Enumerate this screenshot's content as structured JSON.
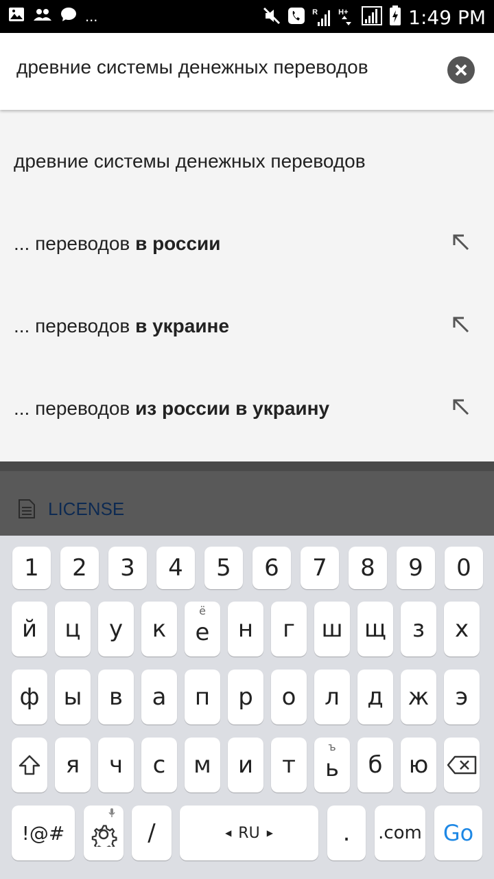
{
  "status_bar": {
    "time": "1:49 PM",
    "overflow": "...",
    "network_r": "R",
    "network_h": "H+"
  },
  "search": {
    "query": "древние системы денежных переводов"
  },
  "suggestions": [
    {
      "prefix": "древние системы денежных переводов",
      "bold": "",
      "has_arrow": false
    },
    {
      "prefix": "... переводов ",
      "bold": "в россии",
      "has_arrow": true
    },
    {
      "prefix": "... переводов ",
      "bold": "в украине",
      "has_arrow": true
    },
    {
      "prefix": "... переводов ",
      "bold": "из россии в украину",
      "has_arrow": true
    }
  ],
  "panel": {
    "license_label": "LICENSE"
  },
  "keyboard": {
    "numbers": [
      "1",
      "2",
      "3",
      "4",
      "5",
      "6",
      "7",
      "8",
      "9",
      "0"
    ],
    "row1": [
      "й",
      "ц",
      "у",
      "к",
      "е",
      "н",
      "г",
      "ш",
      "щ",
      "з",
      "х"
    ],
    "row1_sup_e": "ё",
    "row2": [
      "ф",
      "ы",
      "в",
      "а",
      "п",
      "р",
      "о",
      "л",
      "д",
      "ж",
      "э"
    ],
    "row3": [
      "я",
      "ч",
      "с",
      "м",
      "и",
      "т",
      "ь",
      "б",
      "ю"
    ],
    "row3_sup_soft": "ъ",
    "symbols_label": "!@#",
    "slash_label": "/",
    "language_label": "RU",
    "period_label": ".",
    "dotcom_label": ".com",
    "go_label": "Go",
    "go_color": "#1e88e5"
  }
}
